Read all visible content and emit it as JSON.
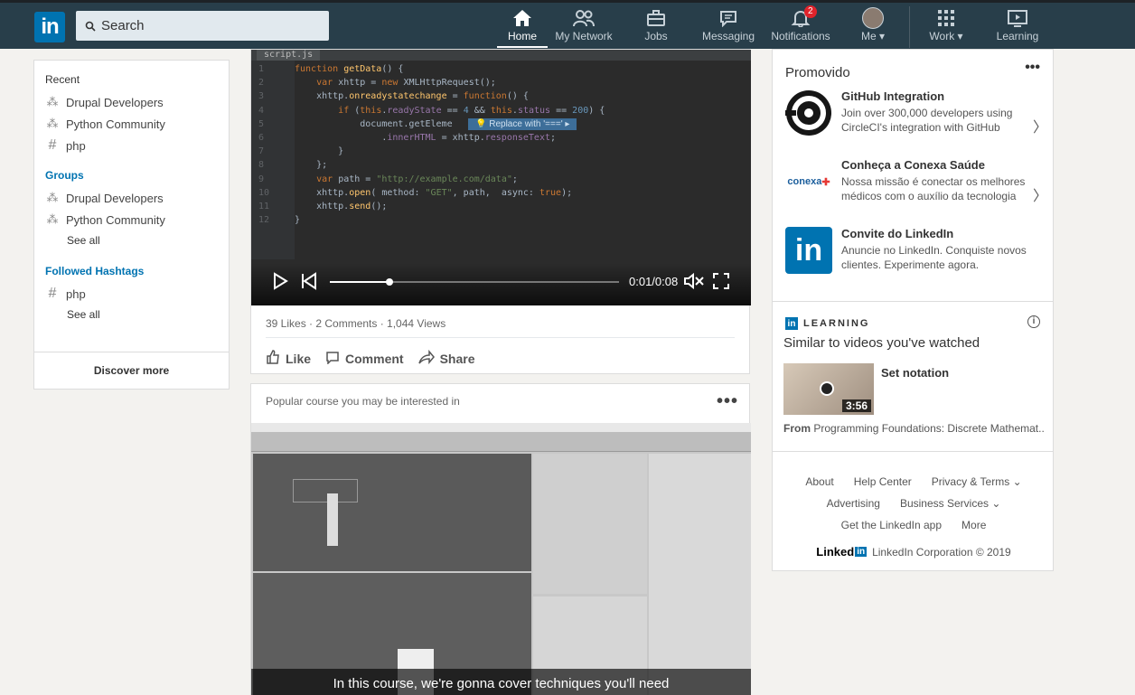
{
  "nav": {
    "logo": "in",
    "search_placeholder": "Search",
    "items": [
      {
        "label": "Home"
      },
      {
        "label": "My Network"
      },
      {
        "label": "Jobs"
      },
      {
        "label": "Messaging"
      },
      {
        "label": "Notifications",
        "badge": "2"
      },
      {
        "label": "Me"
      },
      {
        "label": "Work"
      },
      {
        "label": "Learning"
      }
    ]
  },
  "left_sidebar": {
    "recent_title": "Recent",
    "recent": [
      "Drupal Developers",
      "Python Community",
      "php"
    ],
    "groups_title": "Groups",
    "groups": [
      "Drupal Developers",
      "Python Community"
    ],
    "groups_see_all": "See all",
    "hashtags_title": "Followed Hashtags",
    "hashtags": [
      "php"
    ],
    "hashtags_see_all": "See all",
    "discover_more": "Discover more"
  },
  "video_post": {
    "tab_name": "script.js",
    "hint": "Replace with '==='",
    "time": "0:01/0:08",
    "progress": 0.15,
    "stats": "39 Likes · 2 Comments · 1,044 Views",
    "actions": {
      "like": "Like",
      "comment": "Comment",
      "share": "Share"
    }
  },
  "course_post": {
    "header": "Popular course you may be interested in",
    "caption": "In this course, we're gonna cover techniques you'll need"
  },
  "right_rail": {
    "promo_title": "Promovido",
    "ads": [
      {
        "title": "GitHub Integration",
        "desc": "Join over 300,000 developers using CircleCI's integration with GitHub"
      },
      {
        "title": "Conheça a Conexa Saúde",
        "desc": "Nossa missão é conectar os melhores médicos com o auxílio da tecnologia"
      },
      {
        "title": "Convite do LinkedIn",
        "desc": "Anuncie no LinkedIn. Conquiste novos clientes. Experimente agora."
      }
    ],
    "learning_label": "LEARNING",
    "learning_title": "Similar to videos you've watched",
    "course_name": "Set notation",
    "duration": "3:56",
    "from_label": "From",
    "from_course": "Programming Foundations: Discrete Mathemat..."
  },
  "footer": {
    "row1": [
      "About",
      "Help Center",
      "Privacy & Terms"
    ],
    "row2": [
      "Advertising",
      "Business Services"
    ],
    "row3": [
      "Get the LinkedIn app",
      "More"
    ],
    "brand": "Linked",
    "brand_in": "in",
    "copyright": "LinkedIn Corporation © 2019"
  }
}
